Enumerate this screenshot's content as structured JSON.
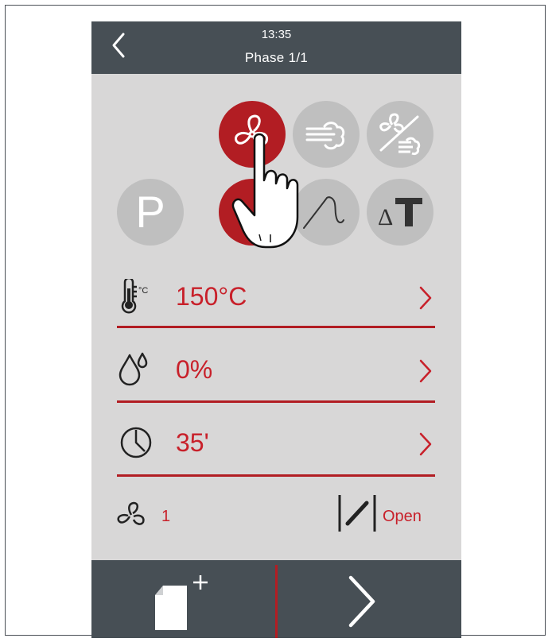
{
  "header": {
    "time": "13:35",
    "phase": "Phase 1/1"
  },
  "modes": {
    "row1": [
      "fan-icon",
      "convection-steam-icon",
      "fan-off-steam-icon"
    ],
    "row2": [
      "p-program",
      "combi-icon",
      "core-probe-icon",
      "delta-t-icon"
    ],
    "p_label": "P",
    "delta_label": "ΔT",
    "active": "fan-icon"
  },
  "settings": {
    "temperature": {
      "unit_symbol": "°C",
      "value": "150°C"
    },
    "humidity": {
      "value": "0%"
    },
    "time": {
      "value": "35'"
    }
  },
  "status": {
    "fan_speed": "1",
    "damper": "Open"
  },
  "footer": {
    "add_icon": "new-document-plus-icon",
    "next_icon": "chevron-right-icon"
  },
  "colors": {
    "accent": "#b21d23",
    "header_bg": "#474f55",
    "screen_bg": "#d8d7d7",
    "inactive_btn": "#bfbfbf"
  }
}
